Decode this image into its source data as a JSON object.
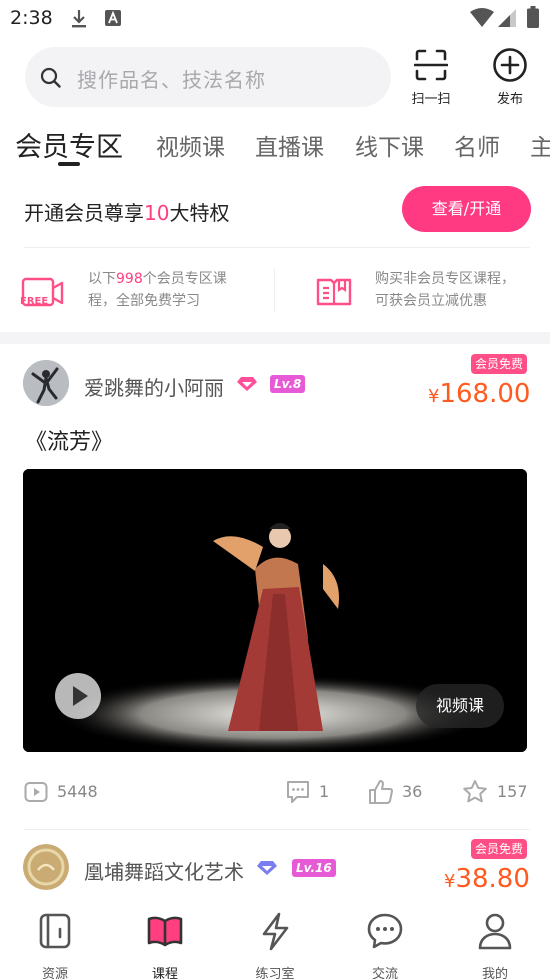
{
  "status_bar": {
    "time": "2:38"
  },
  "search": {
    "placeholder": "搜作品名、技法名称"
  },
  "top_actions": {
    "scan_label": "扫一扫",
    "publish_label": "发布"
  },
  "tabs": [
    {
      "label": "会员专区",
      "active": true
    },
    {
      "label": "视频课",
      "active": false
    },
    {
      "label": "直播课",
      "active": false
    },
    {
      "label": "线下课",
      "active": false
    },
    {
      "label": "名师",
      "active": false
    },
    {
      "label": "主",
      "active": false
    }
  ],
  "membership": {
    "title_prefix": "开通会员尊享",
    "title_number": "10",
    "title_suffix": "大特权",
    "button_label": "查看/开通",
    "perks": [
      {
        "icon": "free-video-icon",
        "line1_prefix": "以下",
        "line1_number": "998",
        "line1_suffix": "个会员专区课",
        "line2": "程，全部免费学习"
      },
      {
        "icon": "book-icon",
        "line1": "购买非会员专区课程，",
        "line2": "可获会员立减优惠"
      }
    ]
  },
  "courses": [
    {
      "author": "爱跳舞的小阿丽",
      "level": "Lv.8",
      "badge": "会员免费",
      "currency": "¥",
      "price": "168.00",
      "title": "《流芳》",
      "video_tag": "视频课",
      "views": "5448",
      "comments": "1",
      "likes": "36",
      "favorites": "157"
    },
    {
      "author": "凰埔舞蹈文化艺术",
      "level": "Lv.16",
      "badge": "会员免费",
      "currency": "¥",
      "price": "38.80"
    }
  ],
  "bottom_nav": [
    {
      "label": "资源",
      "icon": "resource-icon",
      "active": false
    },
    {
      "label": "课程",
      "icon": "course-book-icon",
      "active": true
    },
    {
      "label": "练习室",
      "icon": "lightning-icon",
      "active": false
    },
    {
      "label": "交流",
      "icon": "chat-icon",
      "active": false
    },
    {
      "label": "我的",
      "icon": "profile-icon",
      "active": false
    }
  ],
  "colors": {
    "accent_pink": "#ff3a83",
    "price_orange": "#ff5a1f",
    "level_badge": "#e65ad6"
  }
}
